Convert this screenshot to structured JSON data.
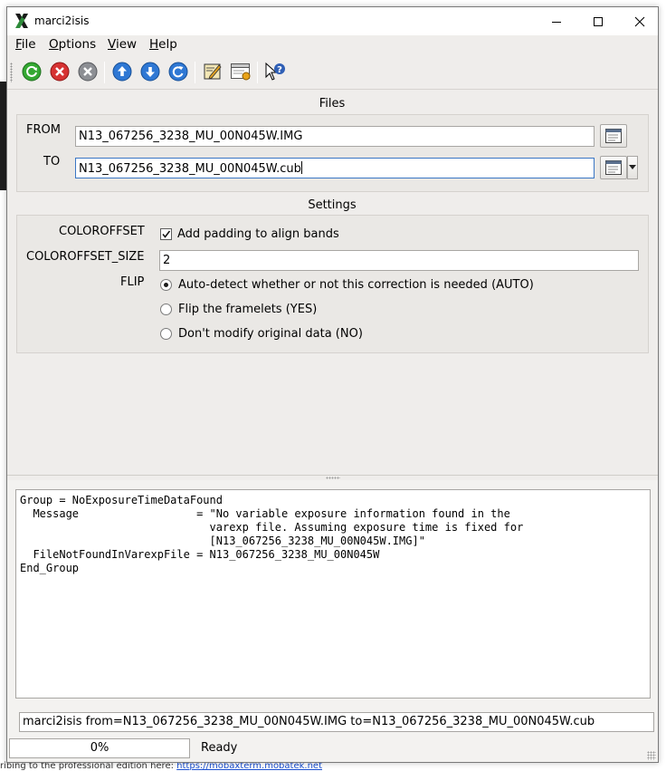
{
  "window": {
    "title": "marci2isis"
  },
  "menu": [
    {
      "label": "File"
    },
    {
      "label": "Options"
    },
    {
      "label": "View"
    },
    {
      "label": "Help"
    }
  ],
  "toolbar": {
    "buttons": [
      "run-icon",
      "stop-icon",
      "cancel-icon",
      "previous-history-icon",
      "next-history-icon",
      "reset-icon",
      "edit-log-icon",
      "preferences-icon",
      "whats-this-help-icon"
    ]
  },
  "files": {
    "title": "Files",
    "from_label": "FROM",
    "from_value": "N13_067256_3238_MU_00N045W.IMG",
    "to_label": "TO",
    "to_value": "N13_067256_3238_MU_00N045W.cub"
  },
  "settings": {
    "title": "Settings",
    "coloroffset_label": "COLOROFFSET",
    "coloroffset_text": "Add padding to align bands",
    "coloroffset_checked": true,
    "coloroffset_size_label": "COLOROFFSET_SIZE",
    "coloroffset_size_value": "2",
    "flip_label": "FLIP",
    "flip_options": [
      {
        "label": "Auto-detect whether or not this correction is needed (AUTO)",
        "selected": true
      },
      {
        "label": "Flip the framelets (YES)",
        "selected": false
      },
      {
        "label": "Don't modify original data (NO)",
        "selected": false
      }
    ]
  },
  "log": {
    "text": "Group = NoExposureTimeDataFound\n  Message                  = \"No variable exposure information found in the\n                             varexp file. Assuming exposure time is fixed for\n                             [N13_067256_3238_MU_00N045W.IMG]\"\n  FileNotFoundInVarexpFile = N13_067256_3238_MU_00N045W\nEnd_Group"
  },
  "command_line": "marci2isis from=N13_067256_3238_MU_00N045W.IMG to=N13_067256_3238_MU_00N045W.cub",
  "progress": {
    "label": "0%",
    "value": 0
  },
  "status": "Ready",
  "background": {
    "footer_text": "ribing to the professional edition here:",
    "footer_link": "https://mobaxterm.mobatek.net"
  }
}
